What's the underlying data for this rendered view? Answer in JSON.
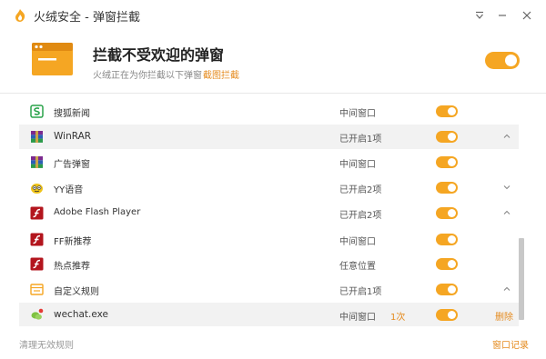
{
  "window": {
    "title": "火绒安全 - 弹窗拦截"
  },
  "header": {
    "title": "拦截不受欢迎的弹窗",
    "subtitle": "火绒正在为你拦截以下弹窗",
    "screenshot_link": "截图拦截",
    "master_toggle_on": true
  },
  "rows": [
    {
      "type": "child",
      "name": "搜狐新闻",
      "icon": "sohu-news-icon",
      "status": "中间窗口",
      "count": "",
      "toggle_on": true,
      "chevron": "",
      "delete": ""
    },
    {
      "type": "group",
      "name": "WinRAR",
      "icon": "winrar-icon",
      "status": "已开启1项",
      "count": "",
      "toggle_on": true,
      "chevron": "up",
      "delete": ""
    },
    {
      "type": "child",
      "name": "广告弹窗",
      "icon": "winrar-icon",
      "status": "中间窗口",
      "count": "",
      "toggle_on": true,
      "chevron": "",
      "delete": ""
    },
    {
      "type": "plain",
      "name": "YY语音",
      "icon": "yy-icon",
      "status": "已开启2项",
      "count": "",
      "toggle_on": true,
      "chevron": "down",
      "delete": ""
    },
    {
      "type": "plain",
      "name": "Adobe Flash Player",
      "icon": "flash-icon",
      "status": "已开启2项",
      "count": "",
      "toggle_on": true,
      "chevron": "up",
      "delete": ""
    },
    {
      "type": "child",
      "name": "FF新推荐",
      "icon": "flash-icon",
      "status": "中间窗口",
      "count": "",
      "toggle_on": true,
      "chevron": "",
      "delete": ""
    },
    {
      "type": "child",
      "name": "热点推荐",
      "icon": "flash-icon",
      "status": "任意位置",
      "count": "",
      "toggle_on": true,
      "chevron": "",
      "delete": ""
    },
    {
      "type": "plain",
      "name": "自定义规则",
      "icon": "custom-rule-icon",
      "status": "已开启1项",
      "count": "",
      "toggle_on": true,
      "chevron": "up",
      "delete": ""
    },
    {
      "type": "child",
      "name": "wechat.exe",
      "icon": "wechat-icon",
      "status": "中间窗口",
      "count": "1次",
      "toggle_on": true,
      "chevron": "",
      "delete": "删除"
    }
  ],
  "footer": {
    "clean_label": "清理无效规则",
    "log_label": "窗口记录"
  },
  "colors": {
    "accent": "#f5a623",
    "link": "#e58b1f",
    "group_bg": "#f2f2f2"
  }
}
